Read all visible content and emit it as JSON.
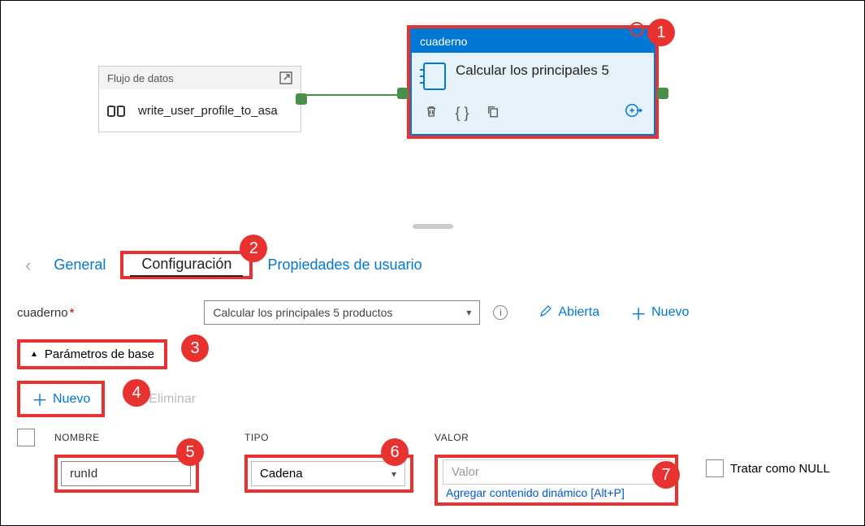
{
  "canvas": {
    "dataflow": {
      "header": "Flujo de datos",
      "name": "write_user_profile_to_asa"
    },
    "notebook": {
      "header": "cuaderno",
      "title": "Calcular los principales 5"
    }
  },
  "callouts": [
    "1",
    "2",
    "3",
    "4",
    "5",
    "6",
    "7"
  ],
  "tabs": {
    "general": "General",
    "config": "Configuración",
    "userprops": "Propiedades de usuario"
  },
  "form": {
    "label": "cuaderno",
    "select_value": "Calcular los principales 5 productos",
    "open": "Abierta",
    "new": "Nuevo",
    "base_params": "Parámetros de base",
    "delete": "Eliminar"
  },
  "grid": {
    "headers": {
      "name": "NOMBRE",
      "type": "TIPO",
      "value": "VALOR"
    },
    "row": {
      "name": "runId",
      "type": "Cadena",
      "value_placeholder": "Valor",
      "dyn_link": "Agregar contenido dinámico [Alt+P]",
      "null_label": "Tratar como NULL"
    }
  }
}
